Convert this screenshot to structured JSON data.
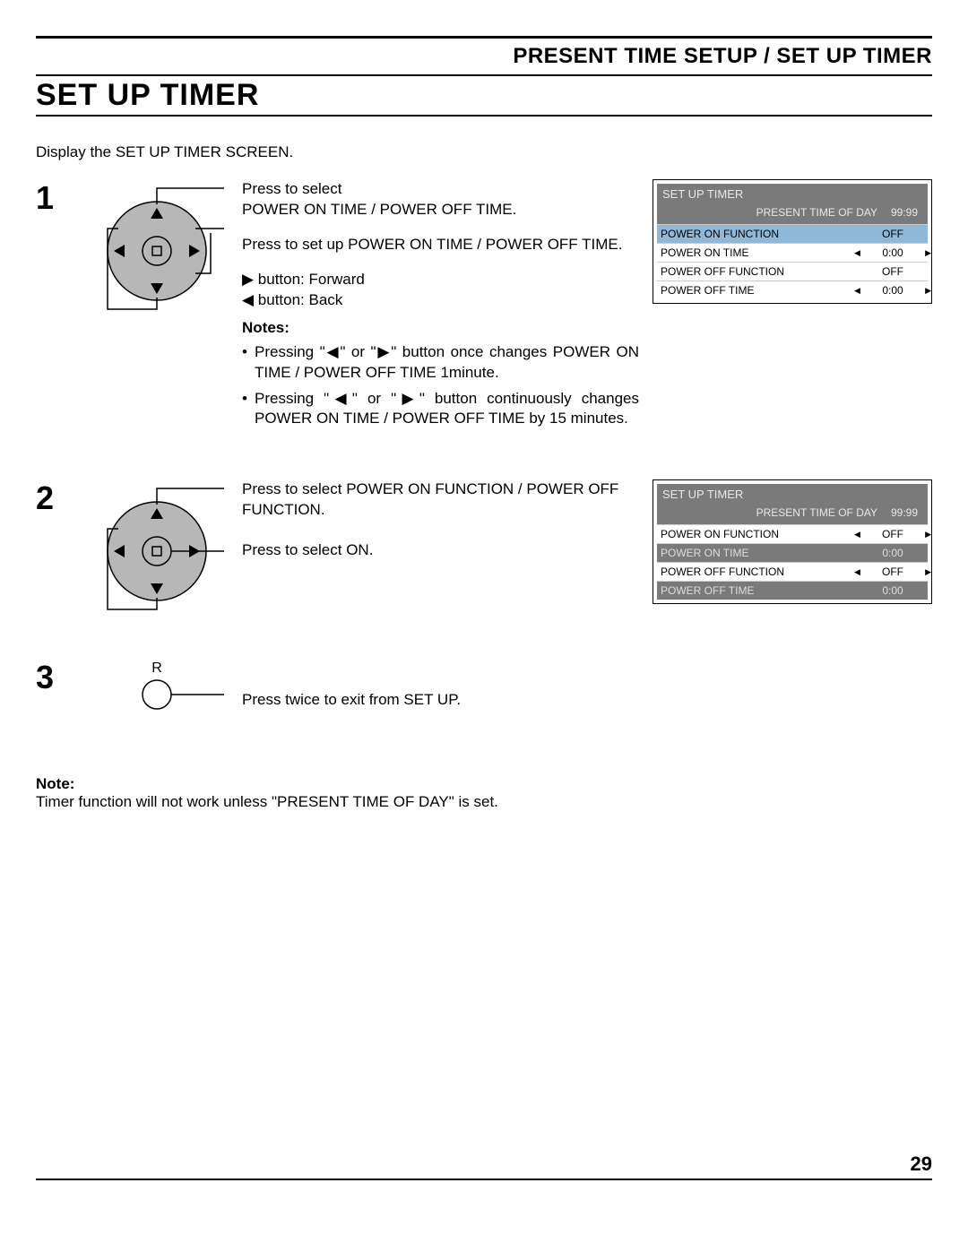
{
  "header": {
    "breadcrumb": "PRESENT TIME SETUP / SET UP TIMER",
    "title": "SET UP TIMER",
    "intro": "Display the SET UP TIMER SCREEN."
  },
  "step1": {
    "num": "1",
    "line1": "Press to select",
    "line1b": "POWER ON TIME / POWER OFF TIME.",
    "line2": "Press to set up POWER ON TIME / POWER OFF TIME.",
    "fwd": "▶ button: Forward",
    "back": "◀ button: Back",
    "notesLabel": "Notes:",
    "note1": "Pressing \"◀\" or \"▶\" button once changes POWER ON TIME / POWER OFF TIME 1minute.",
    "note2": "Pressing \"◀\" or \"▶\" button continuously changes POWER ON TIME / POWER OFF TIME by 15 minutes."
  },
  "step2": {
    "num": "2",
    "line1": "Press to select POWER ON FUNCTION / POWER OFF FUNCTION.",
    "line2": "Press to select ON."
  },
  "step3": {
    "num": "3",
    "label": "R",
    "line1": "Press twice to exit from SET UP."
  },
  "osd1": {
    "title": "SET UP TIMER",
    "presentLabel": "PRESENT  TIME OF DAY",
    "presentVal": "99:99",
    "rows": [
      {
        "label": "POWER ON FUNCTION",
        "val": "OFF",
        "hl": true,
        "arrows": false
      },
      {
        "label": "POWER ON TIME",
        "val": "0:00",
        "hl": false,
        "arrows": true
      },
      {
        "label": "POWER OFF FUNCTION",
        "val": "OFF",
        "hl": false,
        "arrows": false
      },
      {
        "label": "POWER OFF TIME",
        "val": "0:00",
        "hl": false,
        "arrows": true
      }
    ]
  },
  "osd2": {
    "title": "SET UP TIMER",
    "presentLabel": "PRESENT  TIME OF DAY",
    "presentVal": "99:99",
    "rows": [
      {
        "label": "POWER ON FUNCTION",
        "val": "OFF",
        "hl": false,
        "arrows": true
      },
      {
        "label": "POWER ON TIME",
        "val": "0:00",
        "dim": true
      },
      {
        "label": "POWER OFF FUNCTION",
        "val": "OFF",
        "hl": false,
        "arrows": true
      },
      {
        "label": "POWER OFF TIME",
        "val": "0:00",
        "dim": true,
        "hl": true
      }
    ]
  },
  "footer": {
    "noteLabel": "Note:",
    "noteText": "Timer function will not work unless \"PRESENT TIME OF DAY\" is set.",
    "pageNum": "29"
  }
}
